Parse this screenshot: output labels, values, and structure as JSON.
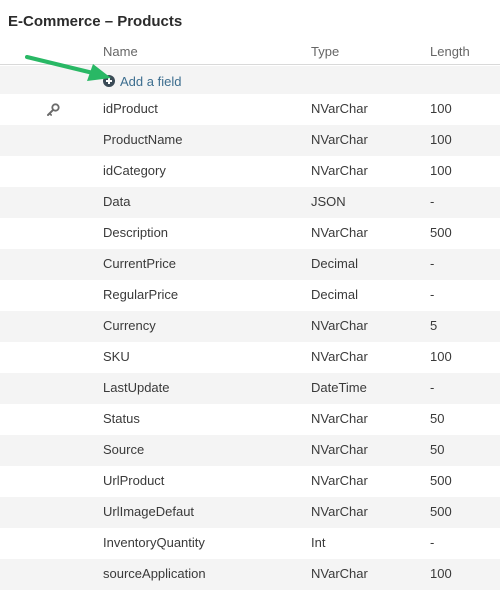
{
  "page": {
    "title": "E-Commerce – Products"
  },
  "columns": {
    "name": "Name",
    "type": "Type",
    "length": "Length"
  },
  "add_field": {
    "label": "Add a field",
    "icon": "plus-circle-icon"
  },
  "colors": {
    "accent_link": "#3d6e8f",
    "arrow": "#29b865",
    "stripe": "#f4f4f4"
  },
  "fields": [
    {
      "name": "idProduct",
      "type": "NVarChar",
      "length": "100",
      "primary_key": true
    },
    {
      "name": "ProductName",
      "type": "NVarChar",
      "length": "100"
    },
    {
      "name": "idCategory",
      "type": "NVarChar",
      "length": "100"
    },
    {
      "name": "Data",
      "type": "JSON",
      "length": "-"
    },
    {
      "name": "Description",
      "type": "NVarChar",
      "length": "500"
    },
    {
      "name": "CurrentPrice",
      "type": "Decimal",
      "length": "-"
    },
    {
      "name": "RegularPrice",
      "type": "Decimal",
      "length": "-"
    },
    {
      "name": "Currency",
      "type": "NVarChar",
      "length": "5"
    },
    {
      "name": "SKU",
      "type": "NVarChar",
      "length": "100"
    },
    {
      "name": "LastUpdate",
      "type": "DateTime",
      "length": "-"
    },
    {
      "name": "Status",
      "type": "NVarChar",
      "length": "50"
    },
    {
      "name": "Source",
      "type": "NVarChar",
      "length": "50"
    },
    {
      "name": "UrlProduct",
      "type": "NVarChar",
      "length": "500"
    },
    {
      "name": "UrlImageDefaut",
      "type": "NVarChar",
      "length": "500"
    },
    {
      "name": "InventoryQuantity",
      "type": "Int",
      "length": "-"
    },
    {
      "name": "sourceApplication",
      "type": "NVarChar",
      "length": "100"
    }
  ]
}
